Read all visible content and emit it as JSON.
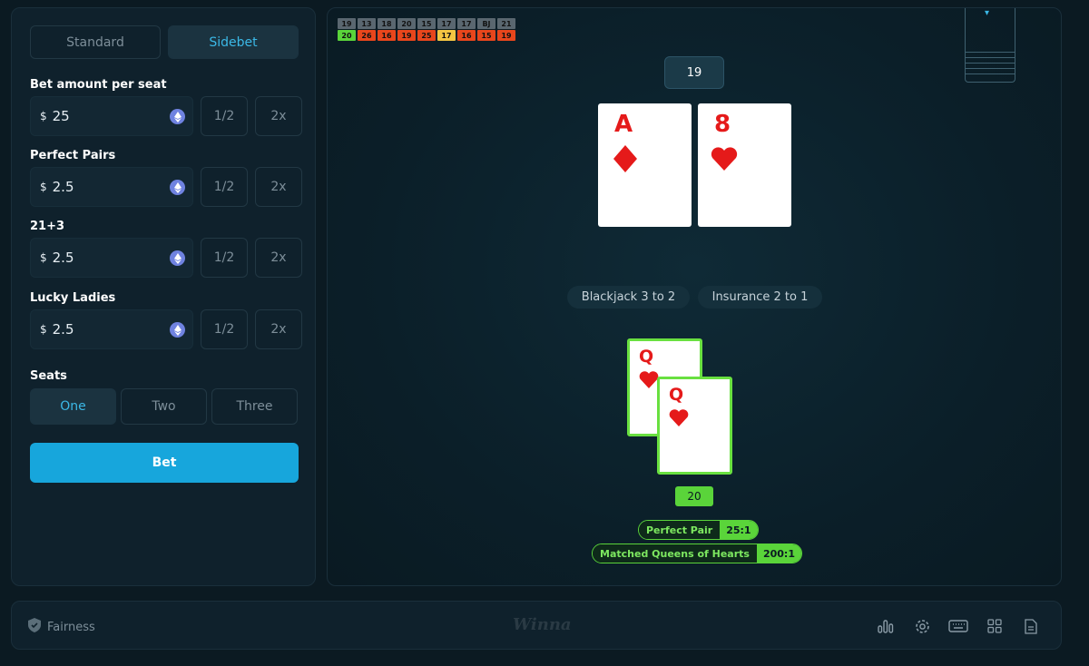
{
  "sidebar": {
    "tabs": [
      {
        "label": "Standard",
        "active": false
      },
      {
        "label": "Sidebet",
        "active": true
      }
    ],
    "fields": [
      {
        "label": "Bet amount per seat",
        "currency": "$",
        "value": "25",
        "half": "1/2",
        "double": "2x"
      },
      {
        "label": "Perfect Pairs",
        "currency": "$",
        "value": "2.5",
        "half": "1/2",
        "double": "2x"
      },
      {
        "label": "21+3",
        "currency": "$",
        "value": "2.5",
        "half": "1/2",
        "double": "2x"
      },
      {
        "label": "Lucky Ladies",
        "currency": "$",
        "value": "2.5",
        "half": "1/2",
        "double": "2x"
      }
    ],
    "seats_label": "Seats",
    "seats": [
      {
        "label": "One",
        "active": true
      },
      {
        "label": "Two",
        "active": false
      },
      {
        "label": "Three",
        "active": false
      }
    ],
    "bet_label": "Bet"
  },
  "history": [
    {
      "top": "19",
      "bottom": "20",
      "color": "#5ad43a"
    },
    {
      "top": "13",
      "bottom": "26",
      "color": "#e8461c"
    },
    {
      "top": "18",
      "bottom": "16",
      "color": "#e8461c"
    },
    {
      "top": "20",
      "bottom": "19",
      "color": "#e8461c"
    },
    {
      "top": "15",
      "bottom": "25",
      "color": "#e8461c"
    },
    {
      "top": "17",
      "bottom": "17",
      "color": "#f4c542"
    },
    {
      "top": "17",
      "bottom": "16",
      "color": "#e8461c"
    },
    {
      "top": "BJ",
      "bottom": "15",
      "color": "#e8461c"
    },
    {
      "top": "21",
      "bottom": "19",
      "color": "#e8461c"
    }
  ],
  "dealer": {
    "score": "19",
    "cards": [
      {
        "rank": "A",
        "suit": "diamond"
      },
      {
        "rank": "8",
        "suit": "heart"
      }
    ]
  },
  "rules": {
    "blackjack": "Blackjack 3 to 2",
    "insurance": "Insurance 2 to 1"
  },
  "player": {
    "score": "20",
    "cards": [
      {
        "rank": "Q",
        "suit": "heart"
      },
      {
        "rank": "Q",
        "suit": "heart"
      }
    ],
    "wins": [
      {
        "label": "Perfect Pair",
        "odds": "25:1"
      },
      {
        "label": "Matched Queens of Hearts",
        "odds": "200:1"
      }
    ]
  },
  "footer": {
    "fairness_label": "Fairness",
    "brand": "Winna",
    "icons": [
      "stats-icon",
      "settings-icon",
      "keyboard-icon",
      "grid-icon",
      "document-icon"
    ]
  },
  "colors": {
    "accent": "#17a6dc",
    "win": "#5ad43a",
    "card_red": "#e51a1a"
  }
}
